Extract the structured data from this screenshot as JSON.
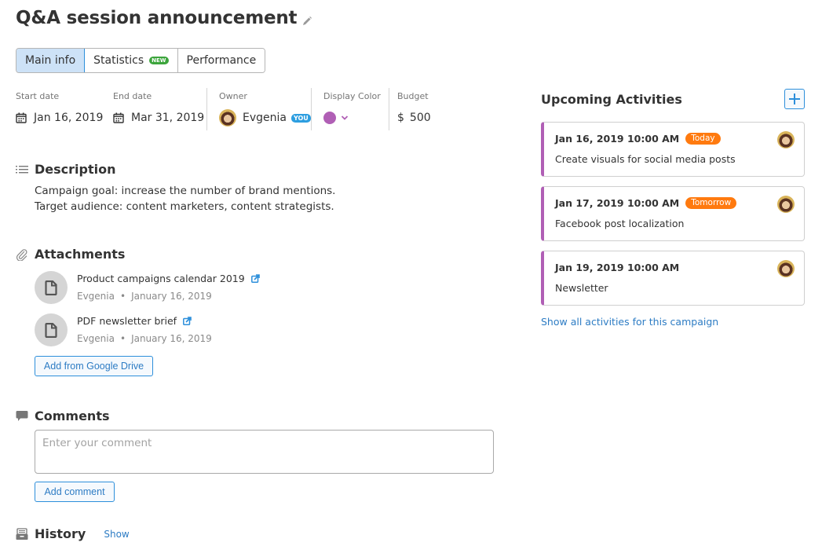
{
  "header": {
    "title": "Q&A session announcement",
    "edit_icon": "pencil-icon"
  },
  "tabs": [
    {
      "label": "Main info",
      "active": true
    },
    {
      "label": "Statistics",
      "badge": "NEW",
      "active": false
    },
    {
      "label": "Performance",
      "active": false
    }
  ],
  "fields": {
    "start_date": {
      "label": "Start date",
      "value": "Jan 16, 2019",
      "icon": "calendar-icon"
    },
    "end_date": {
      "label": "End date",
      "value": "Mar 31, 2019",
      "icon": "calendar-icon"
    },
    "owner": {
      "label": "Owner",
      "value": "Evgenia",
      "badge": "YOU"
    },
    "display_color": {
      "label": "Display Color",
      "value": "#b05fb5"
    },
    "budget": {
      "label": "Budget",
      "currency": "$",
      "value": "500"
    }
  },
  "description": {
    "title": "Description",
    "lines": [
      "Campaign goal: increase the number of brand mentions.",
      "Target audience: content marketers, content strategists."
    ]
  },
  "attachments": {
    "title": "Attachments",
    "items": [
      {
        "name": "Product campaigns calendar 2019",
        "author": "Evgenia",
        "date": "January 16, 2019"
      },
      {
        "name": "PDF newsletter brief",
        "author": "Evgenia",
        "date": "January 16, 2019"
      }
    ],
    "add_button": "Add from Google Drive"
  },
  "comments": {
    "title": "Comments",
    "placeholder": "Enter your comment",
    "value": "",
    "add_button": "Add comment"
  },
  "history": {
    "title": "History",
    "show_link": "Show"
  },
  "upcoming": {
    "title": "Upcoming Activities",
    "add_icon": "plus-icon",
    "items": [
      {
        "datetime": "Jan 16, 2019 10:00 AM",
        "badge": "Today",
        "title": "Create visuals for social media posts"
      },
      {
        "datetime": "Jan 17, 2019 10:00 AM",
        "badge": "Tomorrow",
        "title": "Facebook post localization"
      },
      {
        "datetime": "Jan 19, 2019 10:00 AM",
        "badge": "",
        "title": "Newsletter"
      }
    ],
    "show_all_link": "Show all activities for this campaign"
  },
  "colors": {
    "accent": "#2d8fdb",
    "link": "#2d7cc4",
    "campaign": "#b05fb5",
    "badge_orange": "#ff7a0f",
    "badge_new": "#3ca53c",
    "badge_you": "#2d9ee0"
  }
}
